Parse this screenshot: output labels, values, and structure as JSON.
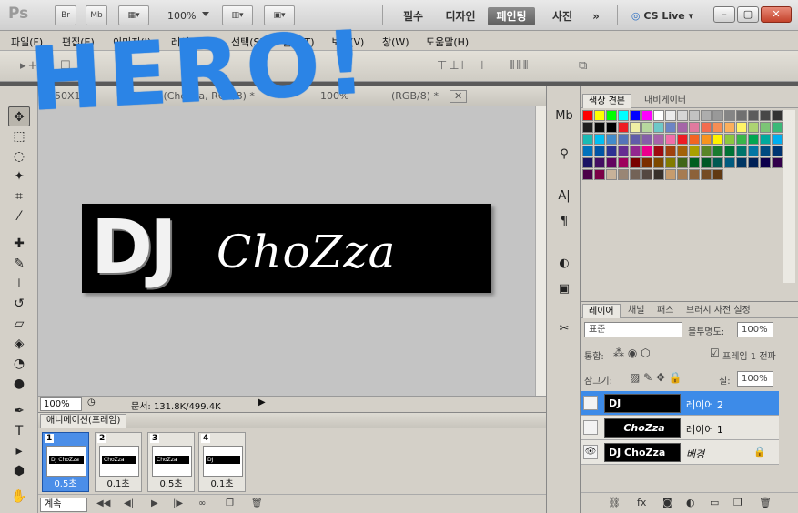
{
  "appbar": {
    "logo": "Ps",
    "bridge": "Br",
    "minibridge": "Mb",
    "zoom": "100%",
    "workspaces": [
      "필수",
      "디자인",
      "페인팅",
      "사진"
    ],
    "more": "»",
    "cslive": "CS Live"
  },
  "menu": [
    "파일(F)",
    "편집(E)",
    "이미지(I)",
    "레이어(L)",
    "선택(S)",
    "필터(T)",
    "보기(V)",
    "창(W)",
    "도움말(H)"
  ],
  "document": {
    "tab1": "50X1",
    "tab2": "@ 100% (ChoZza, RGB/8) *",
    "tab3": "100%",
    "tab3b": "(RGB/8) *",
    "banner_left": "DJ",
    "banner_right": "ChoZza",
    "overlay": "HERO!",
    "status_zoom": "100%",
    "status_doc": "문서: 131.8K/499.4K"
  },
  "animation": {
    "tab": "애니메이션(프레임)",
    "frames": [
      {
        "num": "1",
        "delay": "0.5초",
        "label": "DJ ChoZza"
      },
      {
        "num": "2",
        "delay": "0.1초",
        "label": "ChoZza"
      },
      {
        "num": "3",
        "delay": "0.5초",
        "label": "ChoZza"
      },
      {
        "num": "4",
        "delay": "0.1초",
        "label": "DJ"
      }
    ],
    "loop": "계속"
  },
  "swatches": {
    "tab_active": "색상 견본",
    "tab_other": "내비게이터",
    "colors": [
      "#ff0000",
      "#ffff00",
      "#00ff00",
      "#00ffff",
      "#0000ff",
      "#ff00ff",
      "#ffffff",
      "#ebebeb",
      "#d6d6d6",
      "#c2c2c2",
      "#adadad",
      "#999999",
      "#858585",
      "#707070",
      "#5c5c5c",
      "#474747",
      "#333333",
      "#1f1f1f",
      "#0a0a0a",
      "#000000",
      "#ee1d24",
      "#f0efa4",
      "#b7d79e",
      "#6ec8c8",
      "#6c85c4",
      "#a566a7",
      "#e07a9e",
      "#f26c4f",
      "#f68e55",
      "#fbaf5c",
      "#fff467",
      "#acd372",
      "#7cc576",
      "#3bb878",
      "#1abbb4",
      "#00bff3",
      "#438ccb",
      "#5574b9",
      "#605ca9",
      "#855fa8",
      "#a763a9",
      "#f06ea9",
      "#ed1c24",
      "#f26522",
      "#f7941d",
      "#fff200",
      "#8dc73f",
      "#39b54a",
      "#00a651",
      "#00a99d",
      "#00aeef",
      "#0072bc",
      "#0054a5",
      "#2e3192",
      "#662d91",
      "#92278f",
      "#ec008c",
      "#9e0b0f",
      "#a0410d",
      "#a36209",
      "#aba000",
      "#598527",
      "#197b30",
      "#007236",
      "#00746b",
      "#0076a3",
      "#004a80",
      "#003471",
      "#1b1464",
      "#440e62",
      "#630460",
      "#9e005d",
      "#790000",
      "#7b2e00",
      "#7d4900",
      "#827b00",
      "#406618",
      "#005e20",
      "#005826",
      "#005952",
      "#005b7f",
      "#003663",
      "#002157",
      "#0d004c",
      "#32004b",
      "#4b0049",
      "#7b0046",
      "#c7b299",
      "#998675",
      "#736357",
      "#534741",
      "#37302a",
      "#c69c6d",
      "#a67c52",
      "#8c6239",
      "#754c24",
      "#603913"
    ]
  },
  "layers": {
    "tabs": [
      "레이어",
      "채널",
      "패스",
      "브러시 사전 설정"
    ],
    "blend": "표준",
    "opacity_label": "불투명도:",
    "opacity": "100%",
    "unify_label": "통합:",
    "propagate_label": "프레임 1 전파",
    "lock_label": "잠그기:",
    "fill_label": "칠:",
    "fill": "100%",
    "rows": [
      {
        "name": "레이어 2",
        "thumb": "DJ",
        "selected": true
      },
      {
        "name": "레이어 1",
        "thumb": "ChoZza",
        "selected": false
      },
      {
        "name": "배경",
        "thumb": "DJ ChoZza",
        "selected": false
      }
    ]
  }
}
